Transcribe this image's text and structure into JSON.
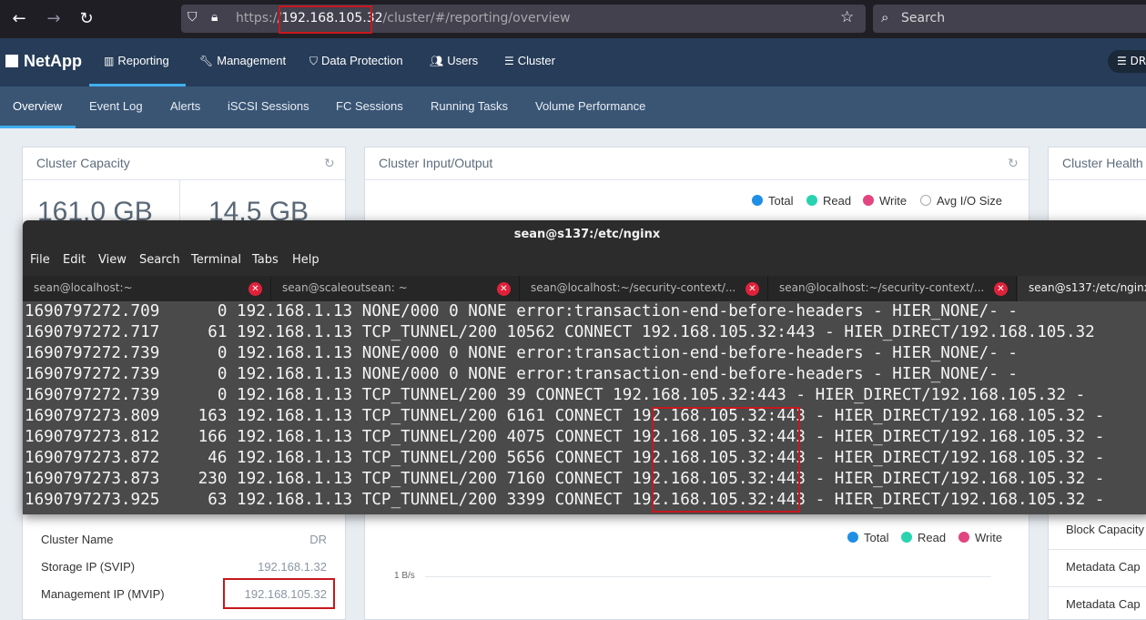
{
  "browser": {
    "url_scheme": "https://",
    "url_host": "192.168.105.32",
    "url_path": "/cluster/#/reporting/overview",
    "search_placeholder": "Search"
  },
  "app": {
    "logo": "NetApp",
    "main_tabs": [
      {
        "label": "Reporting",
        "icon": "bar-chart-icon"
      },
      {
        "label": "Management",
        "icon": "wrench-icon"
      },
      {
        "label": "Data Protection",
        "icon": "shield-icon"
      },
      {
        "label": "Users",
        "icon": "users-icon"
      },
      {
        "label": "Cluster",
        "icon": "server-icon"
      }
    ],
    "cluster_badge": "DR",
    "sub_tabs": [
      "Overview",
      "Event Log",
      "Alerts",
      "iSCSI Sessions",
      "FC Sessions",
      "Running Tasks",
      "Volume Performance"
    ]
  },
  "capacity": {
    "title": "Cluster Capacity",
    "value_left": "161.0 GB",
    "value_right": "14.5 GB"
  },
  "io": {
    "title": "Cluster Input/Output",
    "legend": [
      "Total",
      "Read",
      "Write",
      "Avg I/O Size"
    ],
    "legend2": [
      "Total",
      "Read",
      "Write"
    ],
    "axis_label": "1 B/s",
    "colors": {
      "total": "#1f8fe5",
      "read": "#29d3b0",
      "write": "#e2457f"
    }
  },
  "health": {
    "title": "Cluster Health",
    "items": [
      "Block Capacity",
      "Metadata Cap",
      "Metadata Cap"
    ]
  },
  "info": {
    "rows": [
      {
        "label": "Cluster Name",
        "value": "DR"
      },
      {
        "label": "Storage IP (SVIP)",
        "value": "192.168.1.32"
      },
      {
        "label": "Management IP (MVIP)",
        "value": "192.168.105.32"
      }
    ]
  },
  "terminal": {
    "title": "sean@s137:/etc/nginx",
    "menu": [
      "File",
      "Edit",
      "View",
      "Search",
      "Terminal",
      "Tabs",
      "Help"
    ],
    "tabs": [
      "sean@localhost:~",
      "sean@scaleoutsean: ~",
      "sean@localhost:~/security-context/...",
      "sean@localhost:~/security-context/...",
      "sean@s137:/etc/nginx"
    ],
    "lines": [
      "1690797272.709      0 192.168.1.13 NONE/000 0 NONE error:transaction-end-before-headers - HIER_NONE/- -",
      "1690797272.717     61 192.168.1.13 TCP_TUNNEL/200 10562 CONNECT 192.168.105.32:443 - HIER_DIRECT/192.168.105.32",
      "1690797272.739      0 192.168.1.13 NONE/000 0 NONE error:transaction-end-before-headers - HIER_NONE/- -",
      "1690797272.739      0 192.168.1.13 NONE/000 0 NONE error:transaction-end-before-headers - HIER_NONE/- -",
      "1690797272.739      0 192.168.1.13 TCP_TUNNEL/200 39 CONNECT 192.168.105.32:443 - HIER_DIRECT/192.168.105.32 -",
      "1690797273.809    163 192.168.1.13 TCP_TUNNEL/200 6161 CONNECT 192.168.105.32:443 - HIER_DIRECT/192.168.105.32 -",
      "1690797273.812    166 192.168.1.13 TCP_TUNNEL/200 4075 CONNECT 192.168.105.32:443 - HIER_DIRECT/192.168.105.32 -",
      "1690797273.872     46 192.168.1.13 TCP_TUNNEL/200 5656 CONNECT 192.168.105.32:443 - HIER_DIRECT/192.168.105.32 -",
      "1690797273.873    230 192.168.1.13 TCP_TUNNEL/200 7160 CONNECT 192.168.105.32:443 - HIER_DIRECT/192.168.105.32 -",
      "1690797273.925     63 192.168.1.13 TCP_TUNNEL/200 3399 CONNECT 192.168.105.32:443 - HIER_DIRECT/192.168.105.32 -"
    ]
  }
}
